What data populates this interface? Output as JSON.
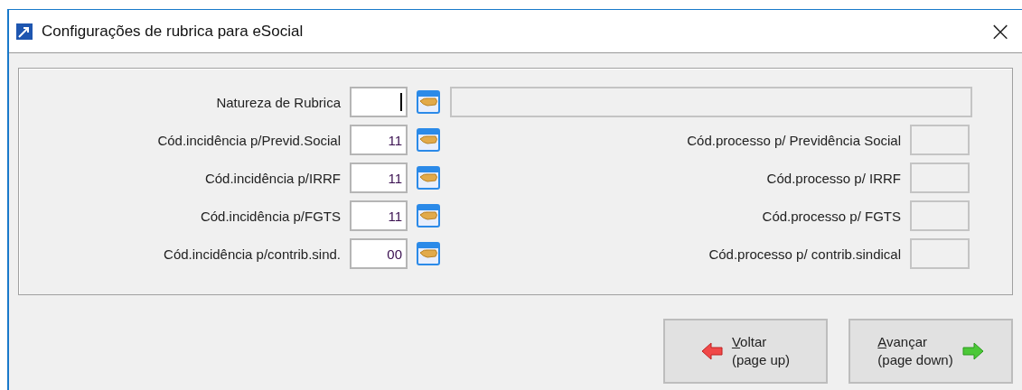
{
  "window": {
    "title": "Configurações de rubrica para eSocial",
    "close": "×"
  },
  "rows": [
    {
      "label": "Natureza de Rubrica",
      "value": "",
      "focused": true,
      "right": {
        "kind": "description"
      }
    },
    {
      "label": "Cód.incidência p/Previd.Social",
      "value": "11",
      "focused": false,
      "right": {
        "kind": "process",
        "label": "Cód.processo p/ Previdência Social"
      }
    },
    {
      "label": "Cód.incidência p/IRRF",
      "value": "11",
      "focused": false,
      "right": {
        "kind": "process",
        "label": "Cód.processo p/ IRRF"
      }
    },
    {
      "label": "Cód.incidência p/FGTS",
      "value": "11",
      "focused": false,
      "right": {
        "kind": "process",
        "label": "Cód.processo p/ FGTS"
      }
    },
    {
      "label": "Cód.incidência p/contrib.sind.",
      "value": "00",
      "focused": false,
      "right": {
        "kind": "process",
        "label": "Cód.processo p/ contrib.sindical"
      }
    }
  ],
  "buttons": [
    {
      "kind": "back",
      "access_key": "V",
      "label_rest": "oltar",
      "hint": "(page up)"
    },
    {
      "kind": "forward",
      "access_key": "A",
      "label_rest": "vançar",
      "hint": "(page down)"
    }
  ]
}
